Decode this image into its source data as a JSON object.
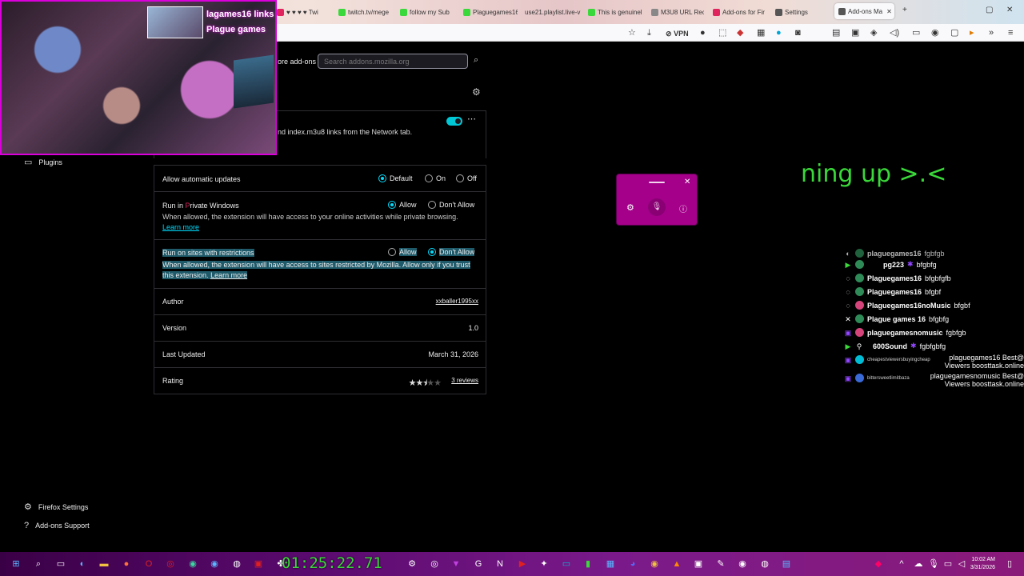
{
  "browser": {
    "tabs": [
      {
        "label": "♥ ♥ ♥ ♥ Twi",
        "color": "#e0245e"
      },
      {
        "label": "twitch.tv/mege",
        "color": "#3ad83a"
      },
      {
        "label": "follow my Sub",
        "color": "#3ad83a"
      },
      {
        "label": "Plaguegames16",
        "color": "#3ad83a"
      },
      {
        "label": "use21.playlist.live-v",
        "color": "#888888"
      },
      {
        "label": "This is genuinel",
        "color": "#3ad83a"
      },
      {
        "label": "M3U8 URL Rec",
        "color": "#888888"
      },
      {
        "label": "Add-ons for Fir",
        "color": "#e0245e"
      },
      {
        "label": "Settings",
        "color": "#555555"
      },
      {
        "label": "Add-ons Ma",
        "color": "#555555",
        "active": true
      }
    ],
    "vpn_label": "VPN"
  },
  "addons": {
    "search_prefix": "ore add-ons",
    "search_placeholder": "Search addons.mozilla.org",
    "description": "nd index.m3u8 links from the Network tab.",
    "rows": {
      "auto_updates": {
        "label": "Allow automatic updates",
        "options": [
          "Default",
          "On",
          "Off"
        ],
        "selected": "Default"
      },
      "private": {
        "label_a": "Run in ",
        "label_b": "P",
        "label_c": "rivate Windows",
        "options": [
          "Allow",
          "Don't Allow"
        ],
        "selected": "Allow",
        "help": "When allowed, the extension will have access to your online activities while private browsing.",
        "learn_more": "Learn more"
      },
      "restricted": {
        "label": "Run on sites with restrictions",
        "options": [
          "Allow",
          "Don't Allow"
        ],
        "selected": "Don't Allow",
        "help": "When allowed, the extension will have access to sites restricted by Mozilla. Allow only if you trust this extension.",
        "learn_more": "Learn more"
      },
      "author": {
        "label": "Author",
        "value": "xxballer1995xx"
      },
      "version": {
        "label": "Version",
        "value": "1.0"
      },
      "updated": {
        "label": "Last Updated",
        "value": "March 31, 2026"
      },
      "rating": {
        "label": "Rating",
        "stars": 2.5,
        "reviews": "3 reviews"
      }
    },
    "sidebar": {
      "plugins": "Plugins",
      "firefox_settings": "Firefox Settings",
      "addons_support": "Add-ons Support"
    }
  },
  "stream": {
    "cam_text_1": "lagames16 links",
    "cam_text_2": "Plague games",
    "overlay_text": "ning up >.<",
    "timer": "01:25:22.71",
    "chat": [
      {
        "user": "plaguegames16",
        "msg": "fgbfgb"
      },
      {
        "user": "pg223",
        "msg": "bfgbfg"
      },
      {
        "user": "Plaguegames16",
        "msg": "bfgbfgfb"
      },
      {
        "user": "Plaguegames16",
        "msg": "bfgbf"
      },
      {
        "user": "Plaguegames16noMusic",
        "msg": "bfgbf"
      },
      {
        "user": "Plague games 16",
        "msg": "bfgbfg"
      },
      {
        "user": "plaguegamesnomusic",
        "msg": "fgbfgb"
      },
      {
        "user": "600Sound",
        "msg": "fgbfgbfg"
      }
    ],
    "chat_bottom": [
      {
        "user": "cheapestviewersbuyingcheap",
        "right1": "plaguegames16 Best@",
        "right2": "Viewers boosttask.online"
      },
      {
        "user": "bittersweetlimitbaza",
        "right1": "plaguegamesnomusic Best@",
        "right2": "Viewers boosttask.online"
      }
    ]
  },
  "taskbar": {
    "time": "10:02 AM",
    "date": "3/31/2026"
  }
}
